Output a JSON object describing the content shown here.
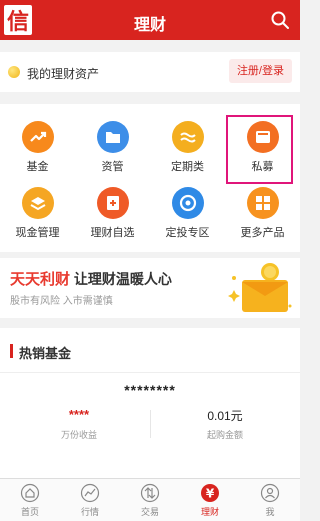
{
  "header": {
    "logo_char": "信",
    "title": "理财"
  },
  "asset": {
    "label": "我的理财资产",
    "action": "注册/登录"
  },
  "grid": [
    {
      "label": "基金",
      "icon": "trend-up-icon",
      "color": "#f7891c"
    },
    {
      "label": "资管",
      "icon": "folder-icon",
      "color": "#3d8ee8"
    },
    {
      "label": "定期类",
      "icon": "wave-icon",
      "color": "#f4ae1f"
    },
    {
      "label": "私募",
      "icon": "wallet-icon",
      "color": "#f36f22"
    },
    {
      "label": "现金管理",
      "icon": "cash-stack-icon",
      "color": "#f5a623"
    },
    {
      "label": "理财自选",
      "icon": "add-favorite-icon",
      "color": "#ef5a27"
    },
    {
      "label": "定投专区",
      "icon": "target-icon",
      "color": "#2f8ae6"
    },
    {
      "label": "更多产品",
      "icon": "grid-more-icon",
      "color": "#f7921e"
    }
  ],
  "banner": {
    "title_red": "天天利财",
    "title_rest": "让理财温暖人心",
    "subtitle": "股市有风险 入市需谨慎"
  },
  "hot": {
    "title": "热销基金",
    "fund": {
      "name": "********",
      "yield": "****",
      "yield_label": "万份收益",
      "min": "0.01元",
      "min_label": "起购金额"
    }
  },
  "tabs": [
    {
      "label": "首页",
      "icon": "home-icon",
      "active": false
    },
    {
      "label": "行情",
      "icon": "market-icon",
      "active": false
    },
    {
      "label": "交易",
      "icon": "trade-icon",
      "active": false
    },
    {
      "label": "理财",
      "icon": "wealth-icon",
      "active": true
    },
    {
      "label": "我",
      "icon": "user-icon",
      "active": false
    }
  ],
  "colors": {
    "brand": "#d8241f",
    "highlight": "#e0157a"
  }
}
